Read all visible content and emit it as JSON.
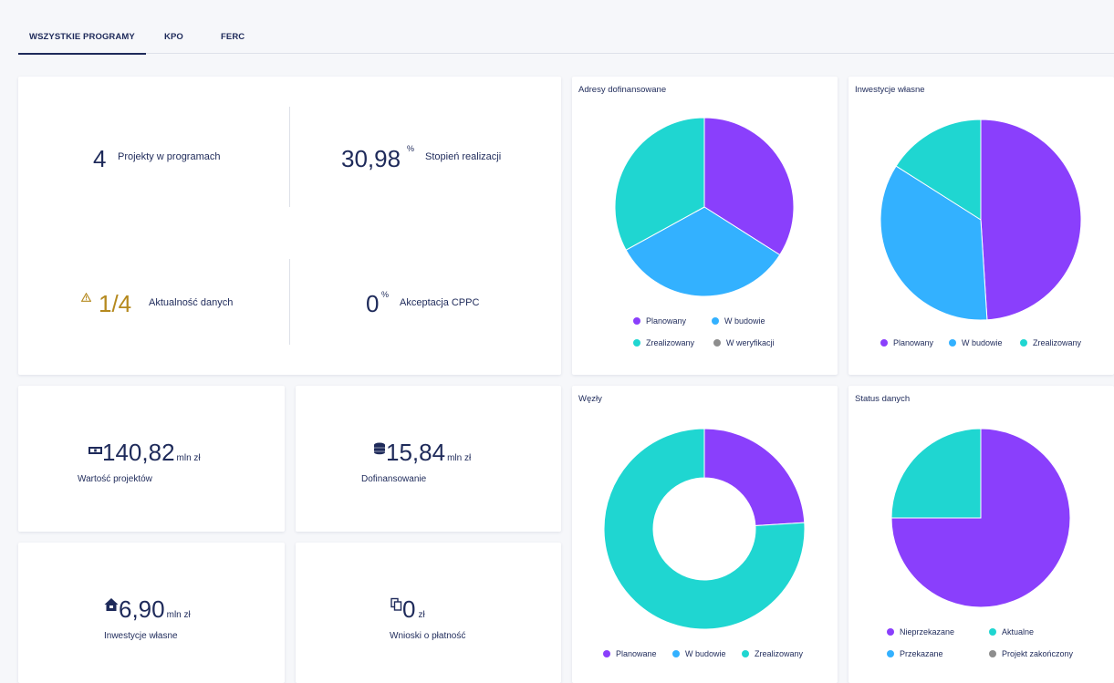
{
  "tabs": [
    {
      "label": "WSZYSTKIE PROGRAMY",
      "active": true
    },
    {
      "label": "KPO",
      "active": false
    },
    {
      "label": "FERC",
      "active": false
    }
  ],
  "stats": {
    "projects": {
      "value": "4",
      "label": "Projekty w programach"
    },
    "realization": {
      "value": "30,98",
      "unit": "%",
      "label": "Stopień realizacji"
    },
    "data_currency": {
      "value": "1/4",
      "label": "Aktualność danych",
      "icon": "warning-icon"
    },
    "cppc": {
      "value": "0",
      "unit": "%",
      "label": "Akceptacja CPPC"
    }
  },
  "money": {
    "project_value": {
      "value": "140,82",
      "unit": "mln zł",
      "label": "Wartość projektów",
      "icon": "money-icon"
    },
    "cofinancing": {
      "value": "15,84",
      "unit": "mln zł",
      "label": "Dofinansowanie",
      "icon": "coins-icon"
    },
    "own_investment": {
      "value": "6,90",
      "unit": "mln zł",
      "label": "Inwestycje własne",
      "icon": "house-icon"
    },
    "payment_requests": {
      "value": "0",
      "unit": "zł",
      "label": "Wnioski o płatność",
      "icon": "copy-icon"
    }
  },
  "colors": {
    "purple": "#8a3ffc",
    "blue": "#33b1ff",
    "teal": "#1fd6d1",
    "gray": "#8d8d8d",
    "warning": "#b5891e",
    "text": "#1e2a5a"
  },
  "chart_data": [
    {
      "type": "pie",
      "title": "Adresy dofinansowane",
      "categories": [
        "Planowany",
        "W budowie",
        "Zrealizowany",
        "W weryfikacji"
      ],
      "values": [
        34,
        33,
        33,
        0
      ],
      "colors": [
        "#8a3ffc",
        "#33b1ff",
        "#1fd6d1",
        "#8d8d8d"
      ],
      "legend": "bottom"
    },
    {
      "type": "pie",
      "title": "Inwestycje własne",
      "categories": [
        "Planowany",
        "W budowie",
        "Zrealizowany"
      ],
      "values": [
        49,
        35,
        16
      ],
      "colors": [
        "#8a3ffc",
        "#33b1ff",
        "#1fd6d1"
      ],
      "legend": "bottom"
    },
    {
      "type": "pie",
      "donut": true,
      "title": "Węzły",
      "categories": [
        "Planowane",
        "W budowie",
        "Zrealizowany"
      ],
      "values": [
        24,
        0,
        76
      ],
      "colors": [
        "#8a3ffc",
        "#33b1ff",
        "#1fd6d1"
      ],
      "legend": "bottom"
    },
    {
      "type": "pie",
      "title": "Status danych",
      "categories": [
        "Nieprzekazane",
        "Aktualne",
        "Przekazane",
        "Projekt zakończony"
      ],
      "values": [
        75,
        25,
        0,
        0
      ],
      "colors": [
        "#8a3ffc",
        "#1fd6d1",
        "#33b1ff",
        "#8d8d8d"
      ],
      "legend": "bottom"
    }
  ]
}
